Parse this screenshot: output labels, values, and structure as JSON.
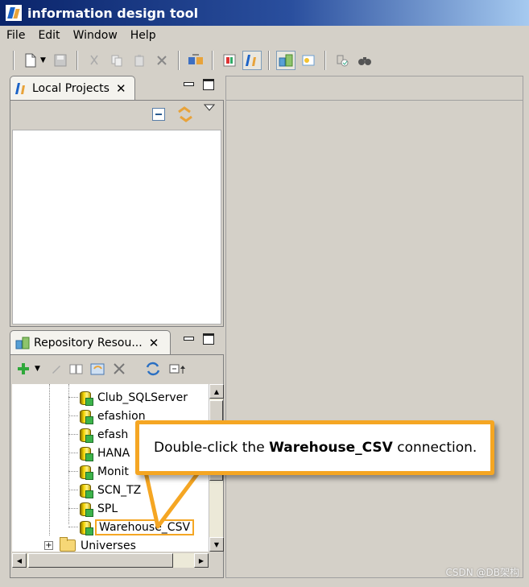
{
  "window": {
    "title": "information design tool"
  },
  "menu": [
    "File",
    "Edit",
    "Window",
    "Help"
  ],
  "local_projects": {
    "tab_label": "Local Projects"
  },
  "repository": {
    "tab_label": "Repository Resou...",
    "items": [
      "Club_SQLServer",
      "efashion",
      "efash",
      "HANA",
      "Monit",
      "SCN_TZ",
      "SPL",
      "Warehouse_CSV"
    ],
    "folder": "Universes"
  },
  "callout": {
    "before": "Double-click the ",
    "bold": "Warehouse_CSV",
    "after": " connection."
  },
  "watermark": "CSDN @DB架构",
  "colors": {
    "highlight": "#f5a623",
    "title_bar": "#0a246a"
  }
}
